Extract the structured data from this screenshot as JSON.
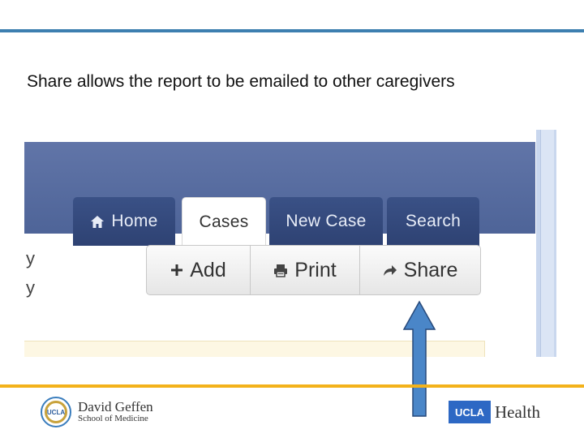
{
  "slide": {
    "title": "Share allows the report to be emailed to other caregivers"
  },
  "nav": {
    "tabs": [
      {
        "label": "Home",
        "icon": "home-icon",
        "active": false
      },
      {
        "label": "Cases",
        "active": true
      },
      {
        "label": "New Case",
        "active": false
      },
      {
        "label": "Search",
        "active": false
      }
    ]
  },
  "left_cut": [
    "y",
    "y"
  ],
  "actions": [
    {
      "label": "Add",
      "icon": "plus-icon"
    },
    {
      "label": "Print",
      "icon": "printer-icon"
    },
    {
      "label": "Share",
      "icon": "share-arrow-icon"
    }
  ],
  "footer": {
    "seal_text": "UCLA",
    "dg_name": "David Geffen",
    "dg_sub": "School of Medicine",
    "ucla_box": "UCLA",
    "health": "Health"
  },
  "colors": {
    "top_rule": "#3d7fb0",
    "bottom_rule": "#f3b21a",
    "navbar": "#5a6ea2",
    "tab_inactive": "#34497c",
    "arrow": "#4a86c8"
  }
}
